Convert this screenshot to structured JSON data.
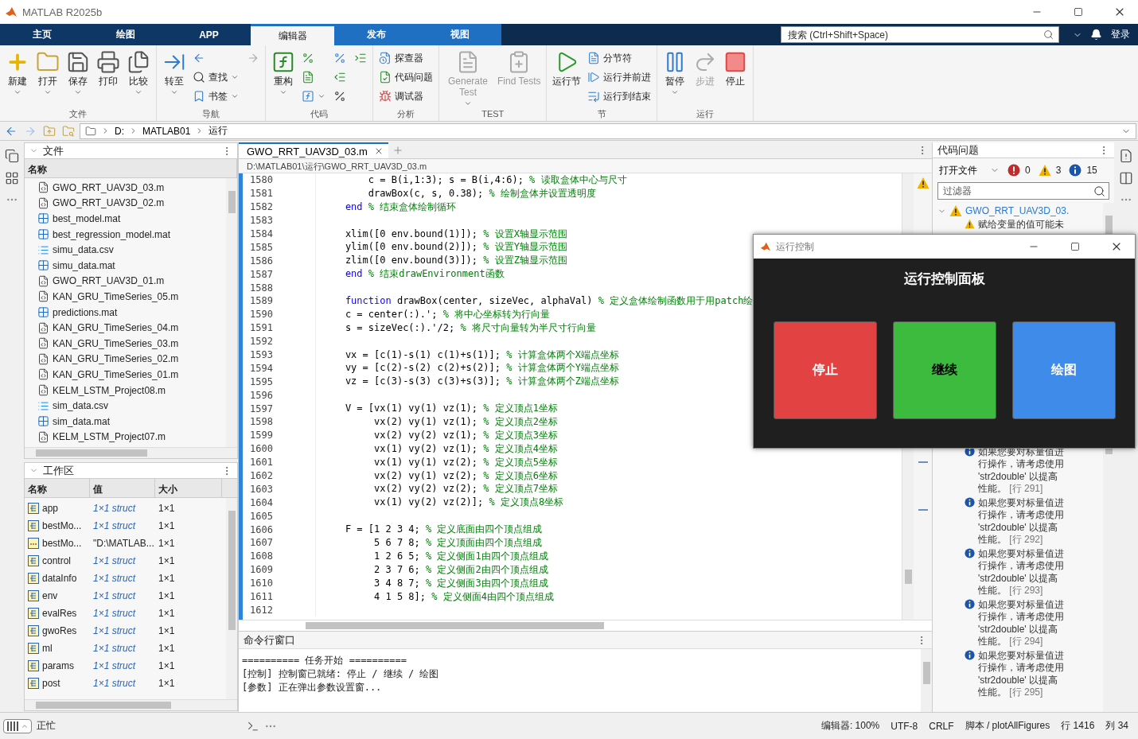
{
  "window": {
    "title": "MATLAB R2025b"
  },
  "tabs": [
    {
      "label": "主页",
      "selected": false,
      "contextual": false
    },
    {
      "label": "绘图",
      "selected": false,
      "contextual": false
    },
    {
      "label": "APP",
      "selected": false,
      "contextual": false
    },
    {
      "label": "编辑器",
      "selected": true,
      "contextual": true
    },
    {
      "label": "发布",
      "selected": false,
      "contextual": true
    },
    {
      "label": "视图",
      "selected": false,
      "contextual": true
    }
  ],
  "search": {
    "placeholder": "搜索 (Ctrl+Shift+Space)"
  },
  "login": "登录",
  "ribbon": {
    "groups": [
      {
        "label": "文件",
        "items": [
          {
            "kind": "large",
            "label": "新建",
            "dropdown": true,
            "disabled": false
          },
          {
            "kind": "large",
            "label": "打开",
            "dropdown": true,
            "disabled": false
          },
          {
            "kind": "large",
            "label": "保存",
            "dropdown": true,
            "disabled": false
          },
          {
            "kind": "large",
            "label": "打印",
            "dropdown": false,
            "disabled": false
          },
          {
            "kind": "large",
            "label": "比较",
            "dropdown": true,
            "disabled": false
          }
        ]
      },
      {
        "label": "导航",
        "items": [
          {
            "kind": "large",
            "label": "转至",
            "dropdown": true,
            "disabled": false
          },
          {
            "kind": "icon",
            "dropdown": false,
            "disabled": false
          },
          {
            "kind": "small",
            "label": "查找",
            "dropdown": true,
            "disabled": false
          },
          {
            "kind": "small",
            "label": "书签",
            "dropdown": true,
            "disabled": false
          },
          {
            "kind": "icon",
            "dropdown": false,
            "disabled": true
          }
        ]
      },
      {
        "label": "代码",
        "items": [
          {
            "kind": "large",
            "label": "重构",
            "dropdown": true,
            "disabled": false
          },
          {
            "kind": "icon",
            "dropdown": false,
            "disabled": false
          },
          {
            "kind": "icon",
            "dropdown": false,
            "disabled": false
          },
          {
            "kind": "icon",
            "dropdown": true,
            "disabled": false
          },
          {
            "kind": "icon",
            "dropdown": false,
            "disabled": false
          },
          {
            "kind": "icon",
            "dropdown": false,
            "disabled": false
          },
          {
            "kind": "icon",
            "dropdown": false,
            "disabled": false
          },
          {
            "kind": "icon",
            "dropdown": false,
            "disabled": false
          }
        ]
      },
      {
        "label": "分析",
        "items": [
          {
            "kind": "small",
            "label": "探查器",
            "dropdown": false,
            "disabled": false
          },
          {
            "kind": "small",
            "label": "代码问题",
            "dropdown": false,
            "disabled": false
          },
          {
            "kind": "small",
            "label": "调试器",
            "dropdown": false,
            "disabled": false
          }
        ]
      },
      {
        "label": "TEST",
        "items": [
          {
            "kind": "large",
            "label": "Generate Test",
            "dropdown": true,
            "disabled": true
          },
          {
            "kind": "large",
            "label": "Find Tests",
            "dropdown": false,
            "disabled": true
          }
        ]
      },
      {
        "label": "节",
        "items": [
          {
            "kind": "large",
            "label": "运行节",
            "dropdown": false,
            "disabled": false
          },
          {
            "kind": "small",
            "label": "分节符",
            "dropdown": false,
            "disabled": false
          },
          {
            "kind": "small",
            "label": "运行并前进",
            "dropdown": false,
            "disabled": false
          },
          {
            "kind": "small",
            "label": "运行到结束",
            "dropdown": false,
            "disabled": false
          }
        ]
      },
      {
        "label": "运行",
        "items": [
          {
            "kind": "large",
            "label": "暂停",
            "dropdown": true,
            "disabled": false
          },
          {
            "kind": "large",
            "label": "步进",
            "dropdown": false,
            "disabled": true
          },
          {
            "kind": "large",
            "label": "停止",
            "dropdown": false,
            "disabled": false
          }
        ]
      }
    ]
  },
  "address": {
    "segments": [
      "D:",
      "MATLAB01",
      "运行"
    ]
  },
  "files": {
    "title": "文件",
    "column": "名称",
    "items": [
      {
        "name": "GWO_RRT_UAV3D_03.m",
        "kind": "script"
      },
      {
        "name": "GWO_RRT_UAV3D_02.m",
        "kind": "script"
      },
      {
        "name": "best_model.mat",
        "kind": "mat"
      },
      {
        "name": "best_regression_model.mat",
        "kind": "mat"
      },
      {
        "name": "simu_data.csv",
        "kind": "csv"
      },
      {
        "name": "simu_data.mat",
        "kind": "mat"
      },
      {
        "name": "GWO_RRT_UAV3D_01.m",
        "kind": "script"
      },
      {
        "name": "KAN_GRU_TimeSeries_05.m",
        "kind": "script"
      },
      {
        "name": "predictions.mat",
        "kind": "mat"
      },
      {
        "name": "KAN_GRU_TimeSeries_04.m",
        "kind": "script"
      },
      {
        "name": "KAN_GRU_TimeSeries_03.m",
        "kind": "script"
      },
      {
        "name": "KAN_GRU_TimeSeries_02.m",
        "kind": "script"
      },
      {
        "name": "KAN_GRU_TimeSeries_01.m",
        "kind": "script"
      },
      {
        "name": "KELM_LSTM_Project08.m",
        "kind": "script"
      },
      {
        "name": "sim_data.csv",
        "kind": "csv"
      },
      {
        "name": "sim_data.mat",
        "kind": "mat"
      },
      {
        "name": "KELM_LSTM_Project07.m",
        "kind": "script"
      }
    ]
  },
  "workspace": {
    "title": "工作区",
    "columns": [
      "名称",
      "值",
      "大小"
    ],
    "rows": [
      {
        "name": "app",
        "value": "1×1 struct",
        "size": "1×1",
        "kind": "struct"
      },
      {
        "name": "bestMo...",
        "value": "1×1 struct",
        "size": "1×1",
        "kind": "struct"
      },
      {
        "name": "bestMo...",
        "value": "\"D:\\MATLAB...",
        "size": "1×1",
        "kind": "string"
      },
      {
        "name": "control",
        "value": "1×1 struct",
        "size": "1×1",
        "kind": "struct"
      },
      {
        "name": "dataInfo",
        "value": "1×1 struct",
        "size": "1×1",
        "kind": "struct"
      },
      {
        "name": "env",
        "value": "1×1 struct",
        "size": "1×1",
        "kind": "struct"
      },
      {
        "name": "evalRes",
        "value": "1×1 struct",
        "size": "1×1",
        "kind": "struct"
      },
      {
        "name": "gwoRes",
        "value": "1×1 struct",
        "size": "1×1",
        "kind": "struct"
      },
      {
        "name": "ml",
        "value": "1×1 struct",
        "size": "1×1",
        "kind": "struct"
      },
      {
        "name": "params",
        "value": "1×1 struct",
        "size": "1×1",
        "kind": "struct"
      },
      {
        "name": "post",
        "value": "1×1 struct",
        "size": "1×1",
        "kind": "struct"
      }
    ]
  },
  "editor": {
    "tabs": [
      {
        "label": "GWO_RRT_UAV3D_03.m",
        "selected": true
      }
    ],
    "path": "D:\\MATLAB01\\运行\\GWO_RRT_UAV3D_03.m",
    "lines": [
      {
        "num": "1580",
        "parts": [
          {
            "kind": "code",
            "text": "        c = B(i,1:3); s = B(i,4:6); "
          },
          {
            "kind": "comment",
            "text": "% 读取盒体中心与尺寸"
          }
        ]
      },
      {
        "num": "1581",
        "parts": [
          {
            "kind": "code",
            "text": "        drawBox(c, s, 0.38); "
          },
          {
            "kind": "comment",
            "text": "% 绘制盒体并设置透明度"
          }
        ]
      },
      {
        "num": "1582",
        "parts": [
          {
            "kind": "keyword",
            "text": "    end "
          },
          {
            "kind": "comment",
            "text": "% 结束盒体绘制循环"
          }
        ]
      },
      {
        "num": "1583"
      },
      {
        "num": "1584",
        "parts": [
          {
            "kind": "code",
            "text": "    xlim([0 env.bound(1)]); "
          },
          {
            "kind": "comment",
            "text": "% 设置X轴显示范围"
          }
        ]
      },
      {
        "num": "1585",
        "parts": [
          {
            "kind": "code",
            "text": "    ylim([0 env.bound(2)]); "
          },
          {
            "kind": "comment",
            "text": "% 设置Y轴显示范围"
          }
        ]
      },
      {
        "num": "1586",
        "parts": [
          {
            "kind": "code",
            "text": "    zlim([0 env.bound(3)]); "
          },
          {
            "kind": "comment",
            "text": "% 设置Z轴显示范围"
          }
        ]
      },
      {
        "num": "1587",
        "parts": [
          {
            "kind": "keyword",
            "text": "    end "
          },
          {
            "kind": "comment",
            "text": "% 结束drawEnvironment函数"
          }
        ]
      },
      {
        "num": "1588"
      },
      {
        "num": "1589",
        "parts": [
          {
            "kind": "keyword",
            "text": "    function "
          },
          {
            "kind": "code",
            "text": "drawBox(center, sizeVec, alphaVal) "
          },
          {
            "kind": "comment",
            "text": "% 定义盒体绘制函数用于用patch绘"
          }
        ]
      },
      {
        "num": "1590",
        "parts": [
          {
            "kind": "code",
            "text": "    c = center(:).'; "
          },
          {
            "kind": "comment",
            "text": "% 将中心坐标转为行向量"
          }
        ]
      },
      {
        "num": "1591",
        "parts": [
          {
            "kind": "code",
            "text": "    s = sizeVec(:).'/2; "
          },
          {
            "kind": "comment",
            "text": "% 将尺寸向量转为半尺寸行向量"
          }
        ]
      },
      {
        "num": "1592"
      },
      {
        "num": "1593",
        "parts": [
          {
            "kind": "code",
            "text": "    vx = [c(1)-s(1) c(1)+s(1)]; "
          },
          {
            "kind": "comment",
            "text": "% 计算盒体两个X端点坐标"
          }
        ]
      },
      {
        "num": "1594",
        "parts": [
          {
            "kind": "code",
            "text": "    vy = [c(2)-s(2) c(2)+s(2)]; "
          },
          {
            "kind": "comment",
            "text": "% 计算盒体两个Y端点坐标"
          }
        ]
      },
      {
        "num": "1595",
        "parts": [
          {
            "kind": "code",
            "text": "    vz = [c(3)-s(3) c(3)+s(3)]; "
          },
          {
            "kind": "comment",
            "text": "% 计算盒体两个Z端点坐标"
          }
        ]
      },
      {
        "num": "1596"
      },
      {
        "num": "1597",
        "parts": [
          {
            "kind": "code",
            "text": "    V = [vx(1) vy(1) vz(1); "
          },
          {
            "kind": "comment",
            "text": "% 定义顶点1坐标"
          }
        ]
      },
      {
        "num": "1598",
        "parts": [
          {
            "kind": "code",
            "text": "         vx(2) vy(1) vz(1); "
          },
          {
            "kind": "comment",
            "text": "% 定义顶点2坐标"
          }
        ]
      },
      {
        "num": "1599",
        "parts": [
          {
            "kind": "code",
            "text": "         vx(2) vy(2) vz(1); "
          },
          {
            "kind": "comment",
            "text": "% 定义顶点3坐标"
          }
        ]
      },
      {
        "num": "1600",
        "parts": [
          {
            "kind": "code",
            "text": "         vx(1) vy(2) vz(1); "
          },
          {
            "kind": "comment",
            "text": "% 定义顶点4坐标"
          }
        ]
      },
      {
        "num": "1601",
        "parts": [
          {
            "kind": "code",
            "text": "         vx(1) vy(1) vz(2); "
          },
          {
            "kind": "comment",
            "text": "% 定义顶点5坐标"
          }
        ]
      },
      {
        "num": "1602",
        "parts": [
          {
            "kind": "code",
            "text": "         vx(2) vy(1) vz(2); "
          },
          {
            "kind": "comment",
            "text": "% 定义顶点6坐标"
          }
        ]
      },
      {
        "num": "1603",
        "parts": [
          {
            "kind": "code",
            "text": "         vx(2) vy(2) vz(2); "
          },
          {
            "kind": "comment",
            "text": "% 定义顶点7坐标"
          }
        ]
      },
      {
        "num": "1604",
        "parts": [
          {
            "kind": "code",
            "text": "         vx(1) vy(2) vz(2)]; "
          },
          {
            "kind": "comment",
            "text": "% 定义顶点8坐标"
          }
        ]
      },
      {
        "num": "1605"
      },
      {
        "num": "1606",
        "parts": [
          {
            "kind": "code",
            "text": "    F = [1 2 3 4; "
          },
          {
            "kind": "comment",
            "text": "% 定义底面由四个顶点组成"
          }
        ]
      },
      {
        "num": "1607",
        "parts": [
          {
            "kind": "code",
            "text": "         5 6 7 8; "
          },
          {
            "kind": "comment",
            "text": "% 定义顶面由四个顶点组成"
          }
        ]
      },
      {
        "num": "1608",
        "parts": [
          {
            "kind": "code",
            "text": "         1 2 6 5; "
          },
          {
            "kind": "comment",
            "text": "% 定义侧面1由四个顶点组成"
          }
        ]
      },
      {
        "num": "1609",
        "parts": [
          {
            "kind": "code",
            "text": "         2 3 7 6; "
          },
          {
            "kind": "comment",
            "text": "% 定义侧面2由四个顶点组成"
          }
        ]
      },
      {
        "num": "1610",
        "parts": [
          {
            "kind": "code",
            "text": "         3 4 8 7; "
          },
          {
            "kind": "comment",
            "text": "% 定义侧面3由四个顶点组成"
          }
        ]
      },
      {
        "num": "1611",
        "parts": [
          {
            "kind": "code",
            "text": "         4 1 5 8]; "
          },
          {
            "kind": "comment",
            "text": "% 定义侧面4由四个顶点组成"
          }
        ]
      },
      {
        "num": "1612"
      }
    ]
  },
  "command_window": {
    "title": "命令行窗口",
    "lines": [
      "========== 任务开始 ==========",
      "[控制] 控制窗已就绪: 停止 / 继续 / 绘图",
      "[参数] 正在弹出参数设置窗..."
    ]
  },
  "code_issues": {
    "title": "代码问题",
    "scope": "打开文件",
    "errors": "0",
    "warnings": "3",
    "infos": "15",
    "filter_placeholder": "过滤器",
    "file": "GWO_RRT_UAV3D_03.",
    "issues": [
      {
        "kind": "warning",
        "text": "赋给变量的值可能未"
      },
      {
        "kind": "info",
        "text": "如果您要对标量值进行操作，请考虑使用 'str2double' 以提高性能。",
        "line": "[行 291]"
      },
      {
        "kind": "info",
        "text": "如果您要对标量值进行操作，请考虑使用 'str2double' 以提高性能。",
        "line": "[行 292]"
      },
      {
        "kind": "info",
        "text": "如果您要对标量值进行操作，请考虑使用 'str2double' 以提高性能。",
        "line": "[行 293]"
      },
      {
        "kind": "info",
        "text": "如果您要对标量值进行操作，请考虑使用 'str2double' 以提高性能。",
        "line": "[行 294]"
      },
      {
        "kind": "info",
        "text": "如果您要对标量值进行操作，请考虑使用 'str2double' 以提高性能。",
        "line": "[行 295]"
      }
    ]
  },
  "dialog": {
    "title": "运行控制",
    "heading": "运行控制面板",
    "buttons": [
      {
        "label": "停止",
        "color": "#e34242"
      },
      {
        "label": "继续",
        "color": "#3dbb3f"
      },
      {
        "label": "绘图",
        "color": "#3f8bea"
      }
    ]
  },
  "status_bar": {
    "state": "正忙",
    "items": [
      "编辑器: 100%",
      "UTF-8",
      "CRLF",
      "脚本 / plotAllFigures",
      "行 1416",
      "列 34"
    ]
  }
}
